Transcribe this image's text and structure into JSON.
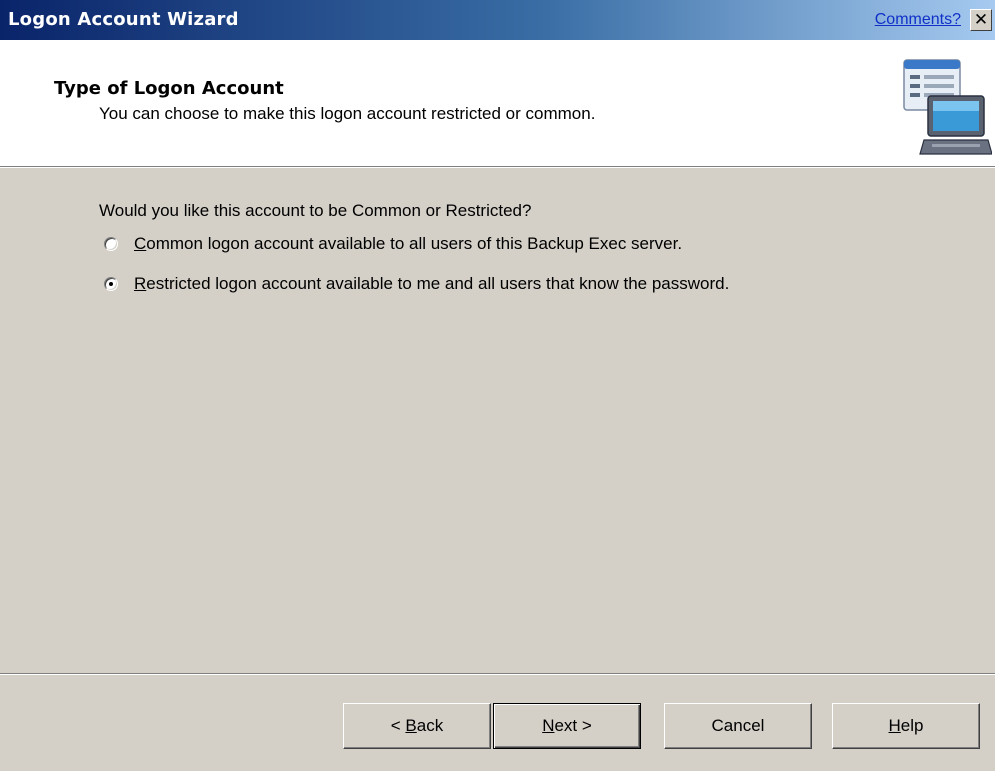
{
  "window": {
    "title": "Logon Account Wizard",
    "comments_link": "Comments?",
    "close_glyph": "✕"
  },
  "header": {
    "title": "Type of Logon Account",
    "subtitle": "You can choose to make this logon account restricted or common.",
    "icon": "computer-wizard-icon"
  },
  "main": {
    "question": "Would you like this account to be Common or Restricted?",
    "options": [
      {
        "mnemonic": "C",
        "label_rest": "ommon logon account available to all users of this Backup Exec server.",
        "selected": false
      },
      {
        "mnemonic": "R",
        "label_rest": "estricted logon account available to me and all users that know the password.",
        "selected": true
      }
    ]
  },
  "buttons": {
    "back_prefix": "< ",
    "back_mnemonic": "B",
    "back_rest": "ack",
    "next_mnemonic": "N",
    "next_rest": "ext >",
    "cancel": "Cancel",
    "help_mnemonic": "H",
    "help_rest": "elp"
  },
  "colors": {
    "dialog_bg": "#d4d0c8",
    "titlebar_start": "#0a246a",
    "titlebar_end": "#a6caf0",
    "link": "#1030c8"
  }
}
